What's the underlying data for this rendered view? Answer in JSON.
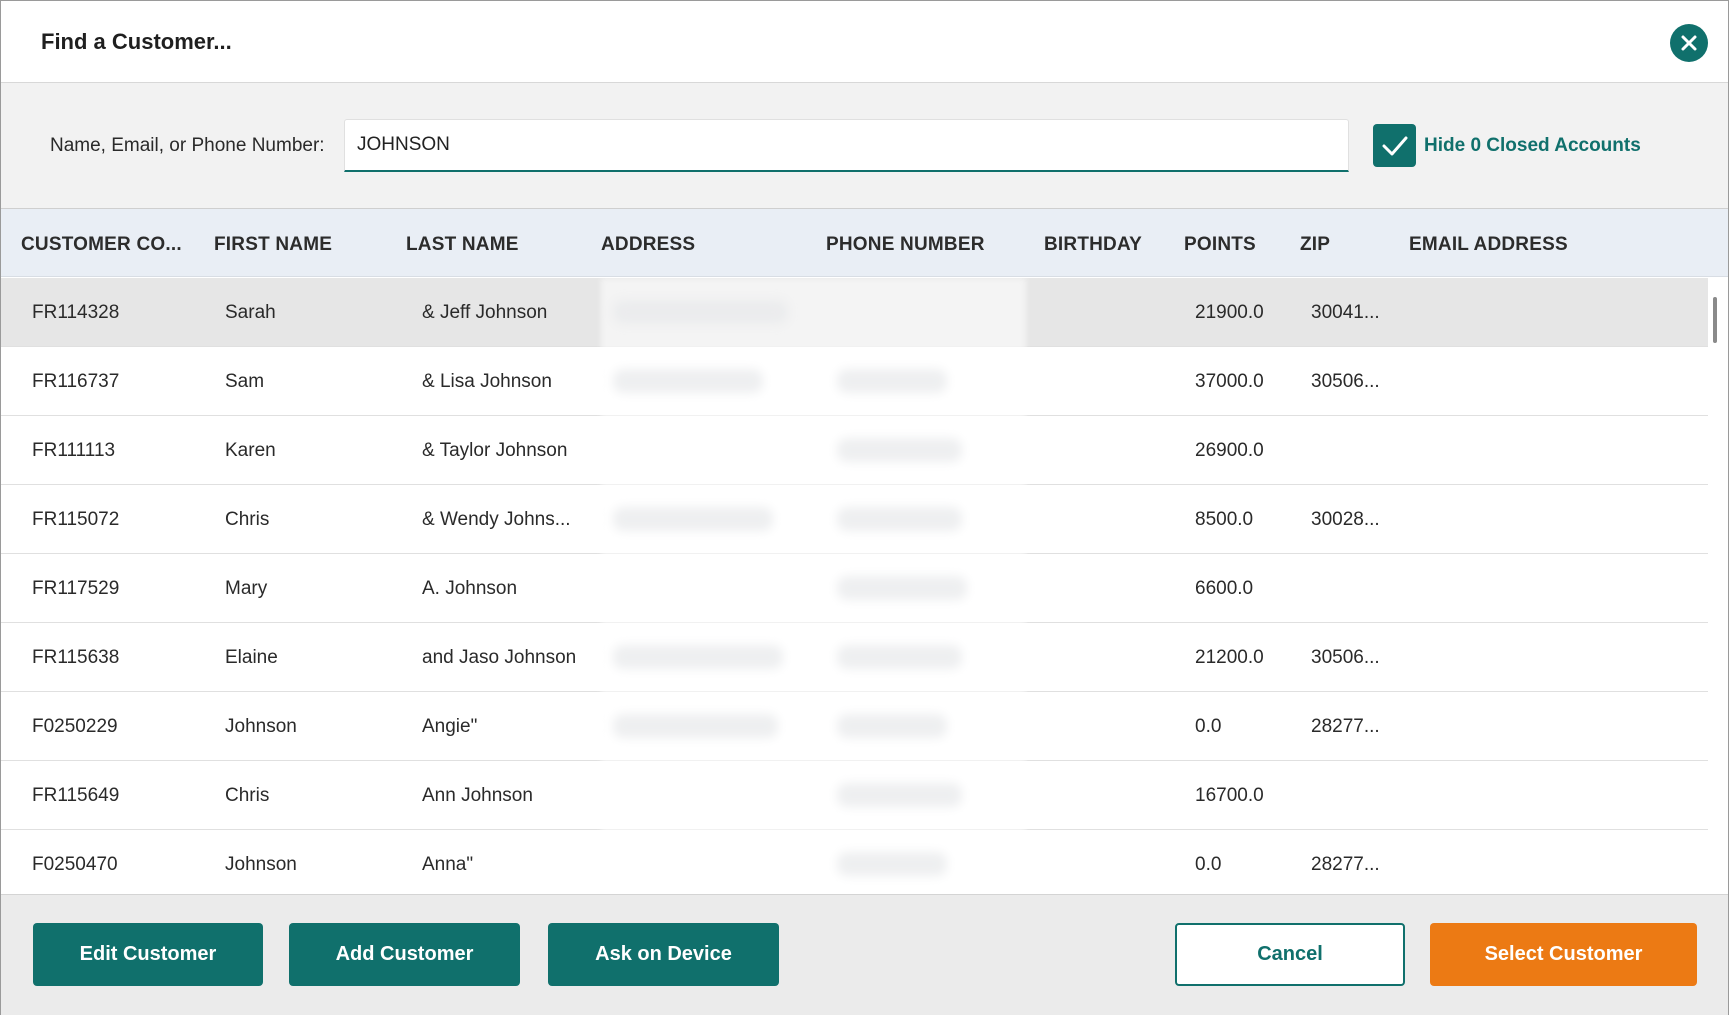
{
  "dialog": {
    "title": "Find a Customer..."
  },
  "search": {
    "label": "Name, Email, or Phone Number:",
    "value": "JOHNSON",
    "hide_closed_label": "Hide 0 Closed Accounts",
    "hide_closed_checked": true
  },
  "table": {
    "columns": [
      "CUSTOMER CO...",
      "FIRST NAME",
      "LAST NAME",
      "ADDRESS",
      "PHONE NUMBER",
      "BIRTHDAY",
      "POINTS",
      "ZIP",
      "EMAIL ADDRESS"
    ],
    "rows": [
      {
        "code": "FR114328",
        "first": "Sarah",
        "last": "& Jeff Johnson",
        "points": "21900.0",
        "zip": "30041..."
      },
      {
        "code": "FR116737",
        "first": "Sam",
        "last": "& Lisa Johnson",
        "points": "37000.0",
        "zip": "30506..."
      },
      {
        "code": "FR111113",
        "first": "Karen",
        "last": "& Taylor Johnson",
        "points": "26900.0",
        "zip": ""
      },
      {
        "code": "FR115072",
        "first": "Chris",
        "last": "& Wendy Johns...",
        "points": "8500.0",
        "zip": "30028..."
      },
      {
        "code": "FR117529",
        "first": "Mary",
        "last": "A. Johnson",
        "points": "6600.0",
        "zip": ""
      },
      {
        "code": "FR115638",
        "first": "Elaine",
        "last": "and Jaso Johnson",
        "points": "21200.0",
        "zip": "30506..."
      },
      {
        "code": "F0250229",
        "first": "Johnson",
        "last": "Angie\"",
        "points": "0.0",
        "zip": "28277..."
      },
      {
        "code": "FR115649",
        "first": "Chris",
        "last": "Ann Johnson",
        "points": "16700.0",
        "zip": ""
      },
      {
        "code": "F0250470",
        "first": "Johnson",
        "last": "Anna\"",
        "points": "0.0",
        "zip": "28277..."
      }
    ],
    "selected_row": 0
  },
  "footer": {
    "edit_label": "Edit Customer",
    "add_label": "Add Customer",
    "ask_label": "Ask on Device",
    "cancel_label": "Cancel",
    "select_label": "Select Customer"
  },
  "colors": {
    "accent": "#10706c",
    "primary_action": "#ec7a14",
    "header_bg": "#e9eef5",
    "selected_row_bg": "#e6e6e6"
  },
  "icons": {
    "close": "close-icon",
    "check": "checkmark-icon"
  }
}
